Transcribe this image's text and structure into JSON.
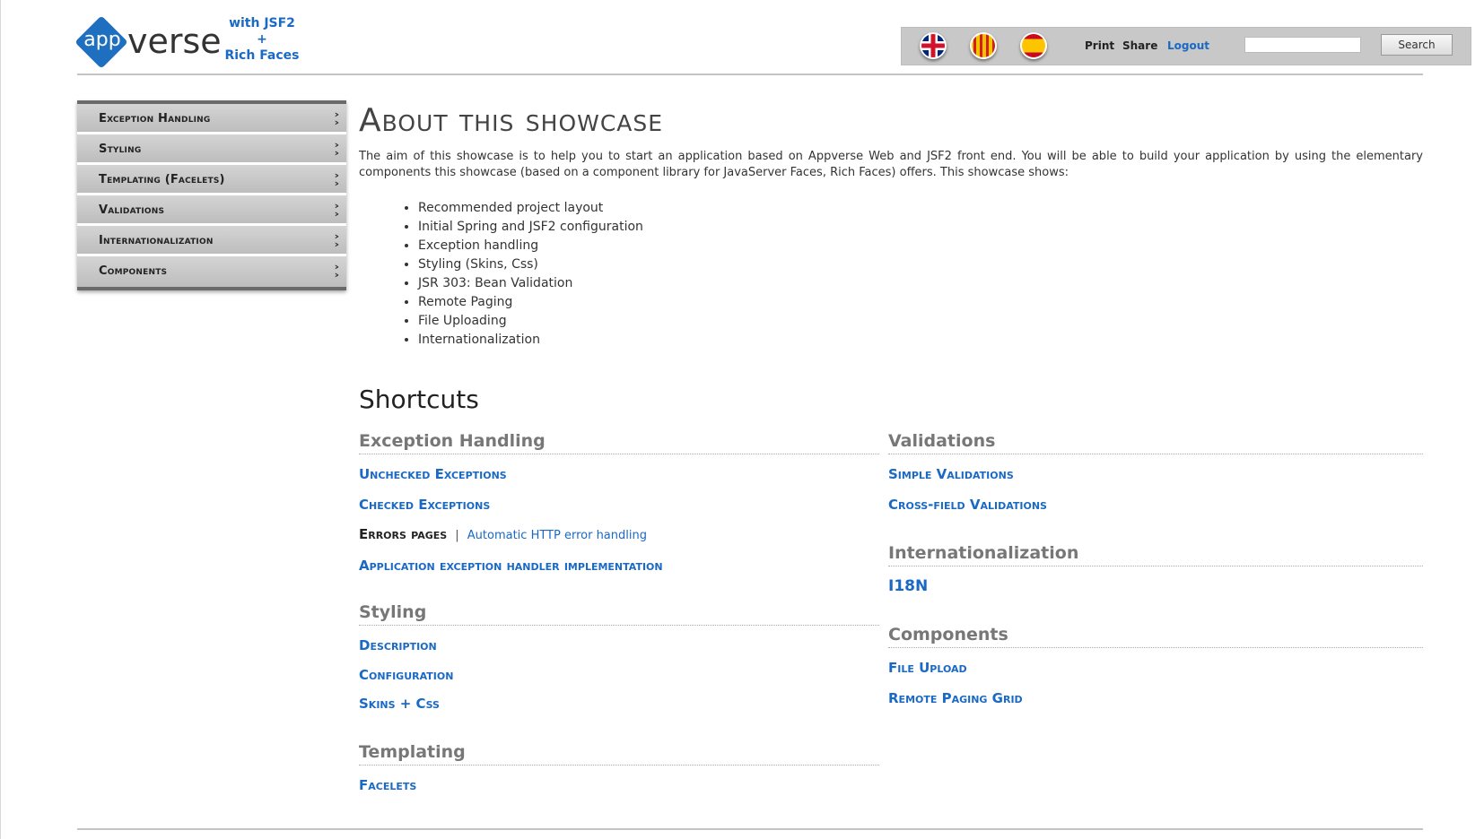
{
  "header": {
    "logo": {
      "app": "app",
      "verse": "verse"
    },
    "tagline": [
      "with JSF2",
      "+",
      "Rich Faces"
    ],
    "flags": [
      "english-flag-icon",
      "catalan-flag-icon",
      "spanish-flag-icon"
    ],
    "links": {
      "print": "Print",
      "share": "Share",
      "logout": "Logout"
    },
    "search": {
      "value": "",
      "button_label": "Search"
    },
    "colors": {
      "brand": "#1f6fc1",
      "topbar": "#c8c8c8",
      "link": "#1a69c4"
    }
  },
  "sidebar": {
    "items": [
      {
        "label": "Exception Handling"
      },
      {
        "label": "Styling"
      },
      {
        "label": "Templating (Facelets)"
      },
      {
        "label": "Validations"
      },
      {
        "label": "Internationalization"
      },
      {
        "label": "Components"
      }
    ],
    "chevron": "»"
  },
  "main": {
    "title": "About this showcase",
    "intro": "The aim of this showcase is to help you to start an application based on Appverse Web and JSF2 front end. You will be able to build your application by using the elementary components this showcase (based on a component library for JavaServer Faces, Rich Faces) offers. This showcase shows:",
    "features": [
      "Recommended project layout",
      "Initial Spring and JSF2 configuration",
      "Exception handling",
      "Styling (Skins, Css)",
      "JSR 303: Bean Validation",
      "Remote Paging",
      "File Uploading",
      "Internationalization"
    ],
    "shortcuts_title": "Shortcuts",
    "shortcuts": {
      "exception_handling": {
        "title": "Exception Handling",
        "unchecked": "Unchecked Exceptions",
        "checked": "Checked Exceptions",
        "errors_pages": "Errors pages",
        "separator": "|",
        "automatic_http": "Automatic HTTP error handling",
        "app_handler": "Application exception handler implementation"
      },
      "styling": {
        "title": "Styling",
        "description": "Description",
        "configuration": "Configuration",
        "skins_css": "Skins + Css"
      },
      "templating": {
        "title": "Templating",
        "facelets": "Facelets"
      },
      "validations": {
        "title": "Validations",
        "simple": "Simple Validations",
        "cross_field": "Cross-field Validations"
      },
      "internationalization": {
        "title": "Internationalization",
        "i18n": "I18N"
      },
      "components": {
        "title": "Components",
        "file_upload": "File Upload",
        "remote_paging_grid": "Remote Paging Grid"
      }
    }
  }
}
